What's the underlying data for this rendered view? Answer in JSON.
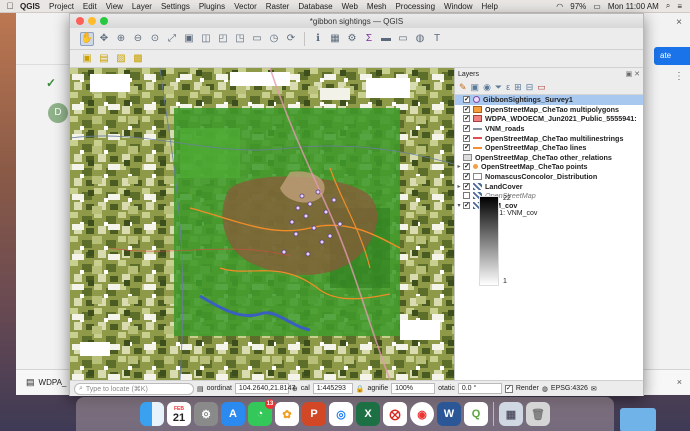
{
  "menubar": {
    "apple": "",
    "app_name": "QGIS",
    "items": [
      "Project",
      "Edit",
      "View",
      "Layer",
      "Settings",
      "Plugins",
      "Vector",
      "Raster",
      "Database",
      "Web",
      "Mesh",
      "Processing",
      "Window",
      "Help"
    ],
    "battery": "97%",
    "clock": "Mon 11:00 AM"
  },
  "browser": {
    "button_partial": "ate",
    "avatar_letter": "D",
    "download_item": "WDPA_",
    "close": "×"
  },
  "window": {
    "title": "*gibbon sightings — QGIS"
  },
  "layers_panel": {
    "title": "Layers",
    "controls": "▣ ✕",
    "layers": [
      {
        "name": "GibbonSightings_Survey1",
        "checked": true,
        "selected": true,
        "symbol": "point"
      },
      {
        "name": "OpenStreetMap_CheTao multipolygons",
        "checked": true,
        "selected": false,
        "symbol": "polygon-orange"
      },
      {
        "name": "WDPA_WDOECM_Jun2021_Public_5555941:",
        "checked": true,
        "selected": false,
        "symbol": "polygon-pink"
      },
      {
        "name": "VNM_roads",
        "checked": true,
        "selected": false,
        "symbol": "line-gray"
      },
      {
        "name": "OpenStreetMap_CheTao multilinestrings",
        "checked": true,
        "selected": false,
        "symbol": "line-red"
      },
      {
        "name": "OpenStreetMap_CheTao lines",
        "checked": true,
        "selected": false,
        "symbol": "line-orange"
      },
      {
        "name": "OpenStreetMap_CheTao other_relations",
        "checked": null,
        "selected": false,
        "symbol": "table"
      },
      {
        "name": "OpenStreetMap_CheTao points",
        "checked": true,
        "selected": false,
        "symbol": "point-orange",
        "twisty": "▸"
      },
      {
        "name": "NomascusConcolor_Distribution",
        "checked": true,
        "selected": false,
        "symbol": "polygon-white"
      },
      {
        "name": "LandCover",
        "checked": true,
        "selected": false,
        "symbol": "raster",
        "twisty": "▸"
      },
      {
        "name": "OpenStreetMap",
        "checked": false,
        "selected": false,
        "symbol": "raster",
        "italic": true
      },
      {
        "name": "VNM_cov",
        "checked": true,
        "selected": false,
        "symbol": "raster",
        "twisty": "▾"
      }
    ],
    "band_label": "Band 1: VNM_cov",
    "ramp_max": "22",
    "ramp_min": "1"
  },
  "statusbar": {
    "locator_placeholder": "Type to locate (⌘K)",
    "coord_label": "oordinat",
    "coord_value": "104.2640,21.8147",
    "scale_label": "cal",
    "scale_value": "1:445293",
    "magnifier_label": "agnifie",
    "magnifier_value": "100%",
    "rotation_label": "otatic",
    "rotation_value": "0.0 °",
    "render_label": "Render",
    "crs": "EPSG:4326"
  },
  "dock": {
    "calendar_month": "FEB",
    "calendar_day": "21",
    "mail_badge": "13",
    "apps": [
      "Finder",
      "Calendar",
      "System Preferences",
      "App Store",
      "Messages",
      "Photos",
      "PowerPoint",
      "Safari",
      "Excel",
      "Acrobat",
      "Chrome",
      "Word",
      "QGIS",
      "Preview",
      "Trash"
    ]
  },
  "colors": {
    "selected_row": "#a9c8ef",
    "accent": "#1a73e8"
  }
}
